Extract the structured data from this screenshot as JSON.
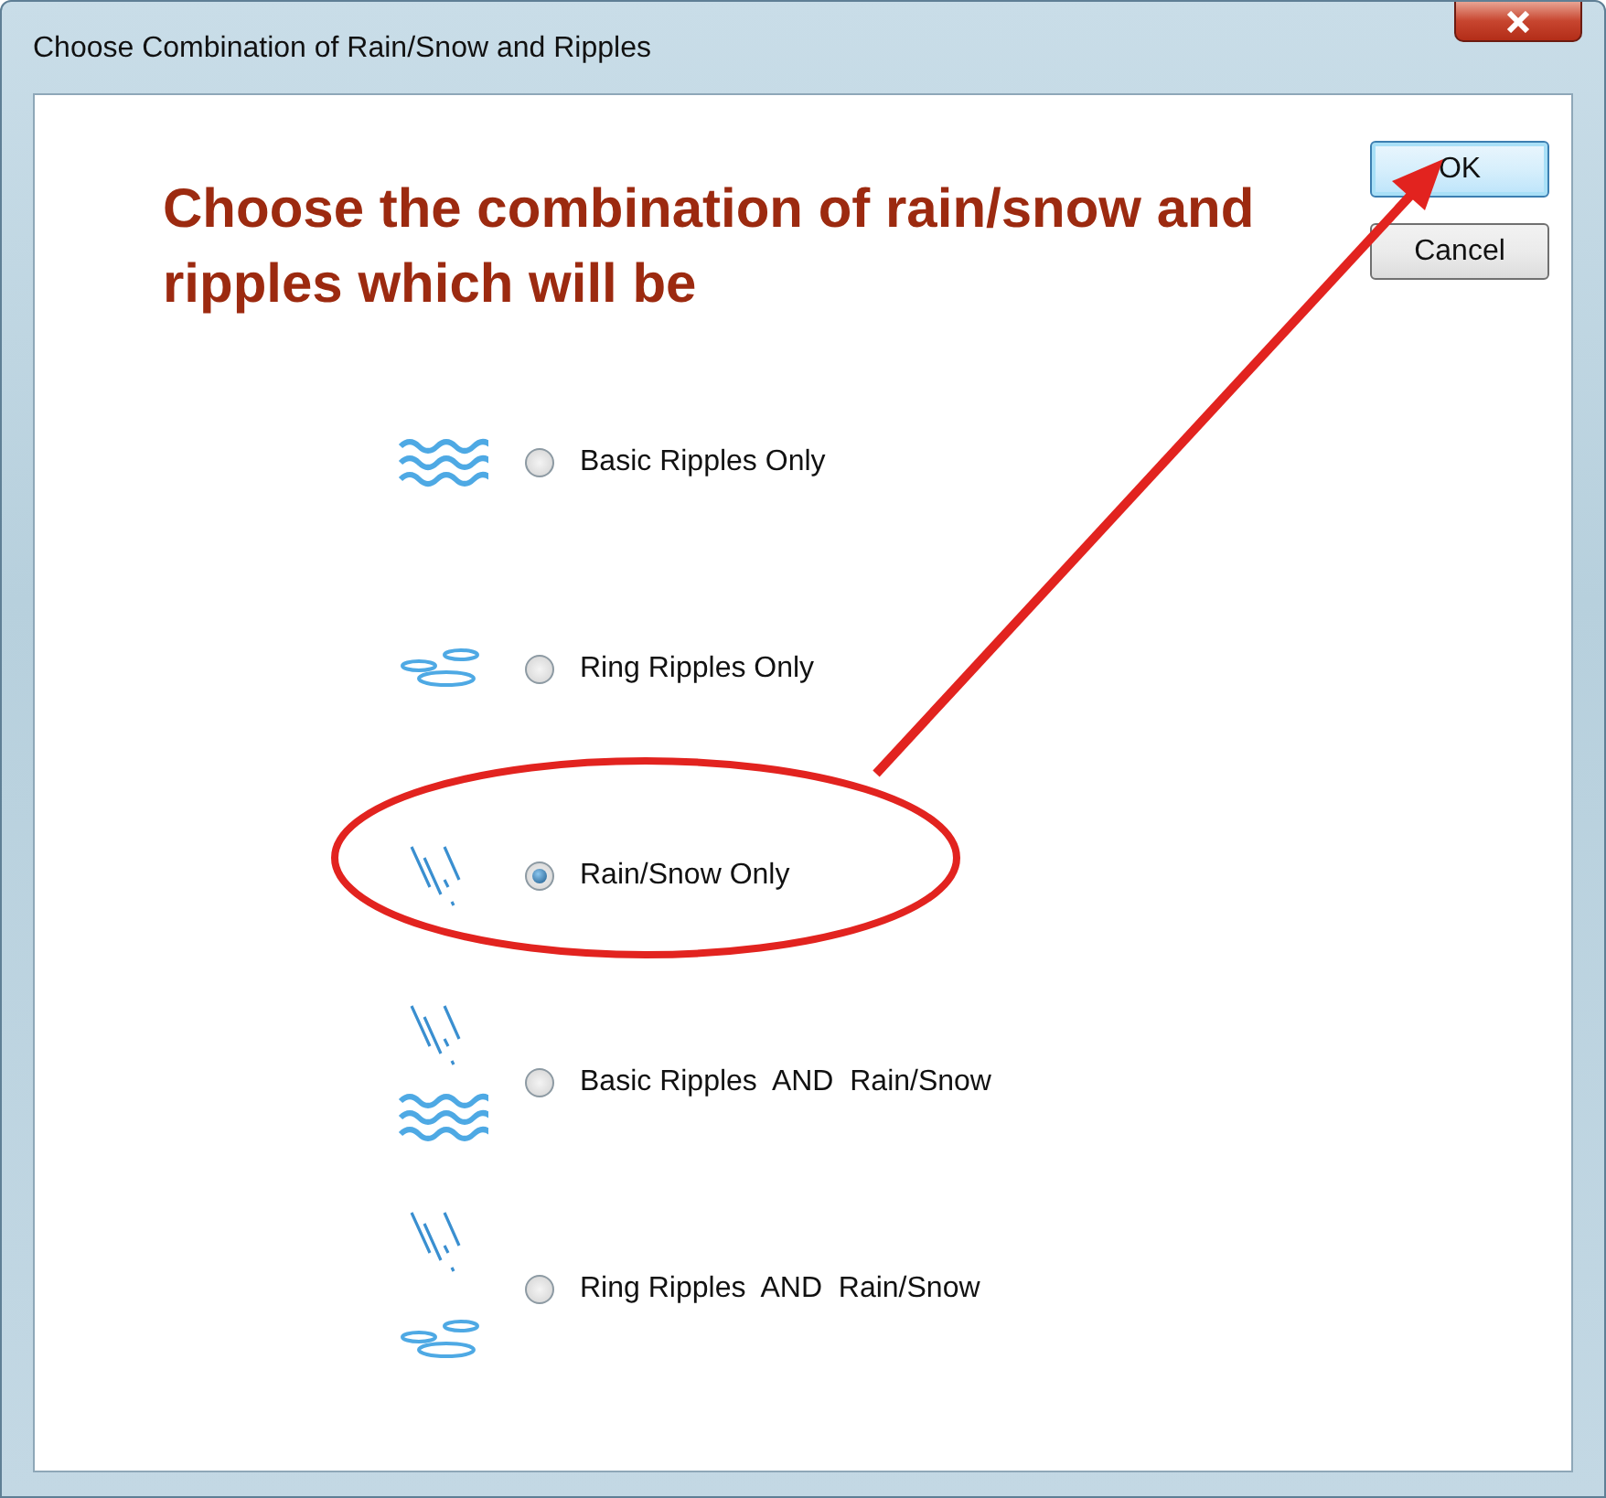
{
  "window": {
    "title": "Choose Combination of Rain/Snow and Ripples"
  },
  "heading": "Choose the combination of rain/snow and ripples which will be",
  "options": [
    {
      "kind": "ripples",
      "label": "Basic Ripples Only",
      "selected": false
    },
    {
      "kind": "rings",
      "label": "Ring Ripples Only",
      "selected": false
    },
    {
      "kind": "rain",
      "label": "Rain/Snow Only",
      "selected": true
    },
    {
      "kind": "rain-ripples",
      "label": "Basic Ripples  AND  Rain/Snow",
      "selected": false
    },
    {
      "kind": "rain-rings",
      "label": "Ring Ripples  AND  Rain/Snow",
      "selected": false
    }
  ],
  "buttons": [
    {
      "label": "OK",
      "default": true
    },
    {
      "label": "Cancel",
      "default": false
    }
  ]
}
